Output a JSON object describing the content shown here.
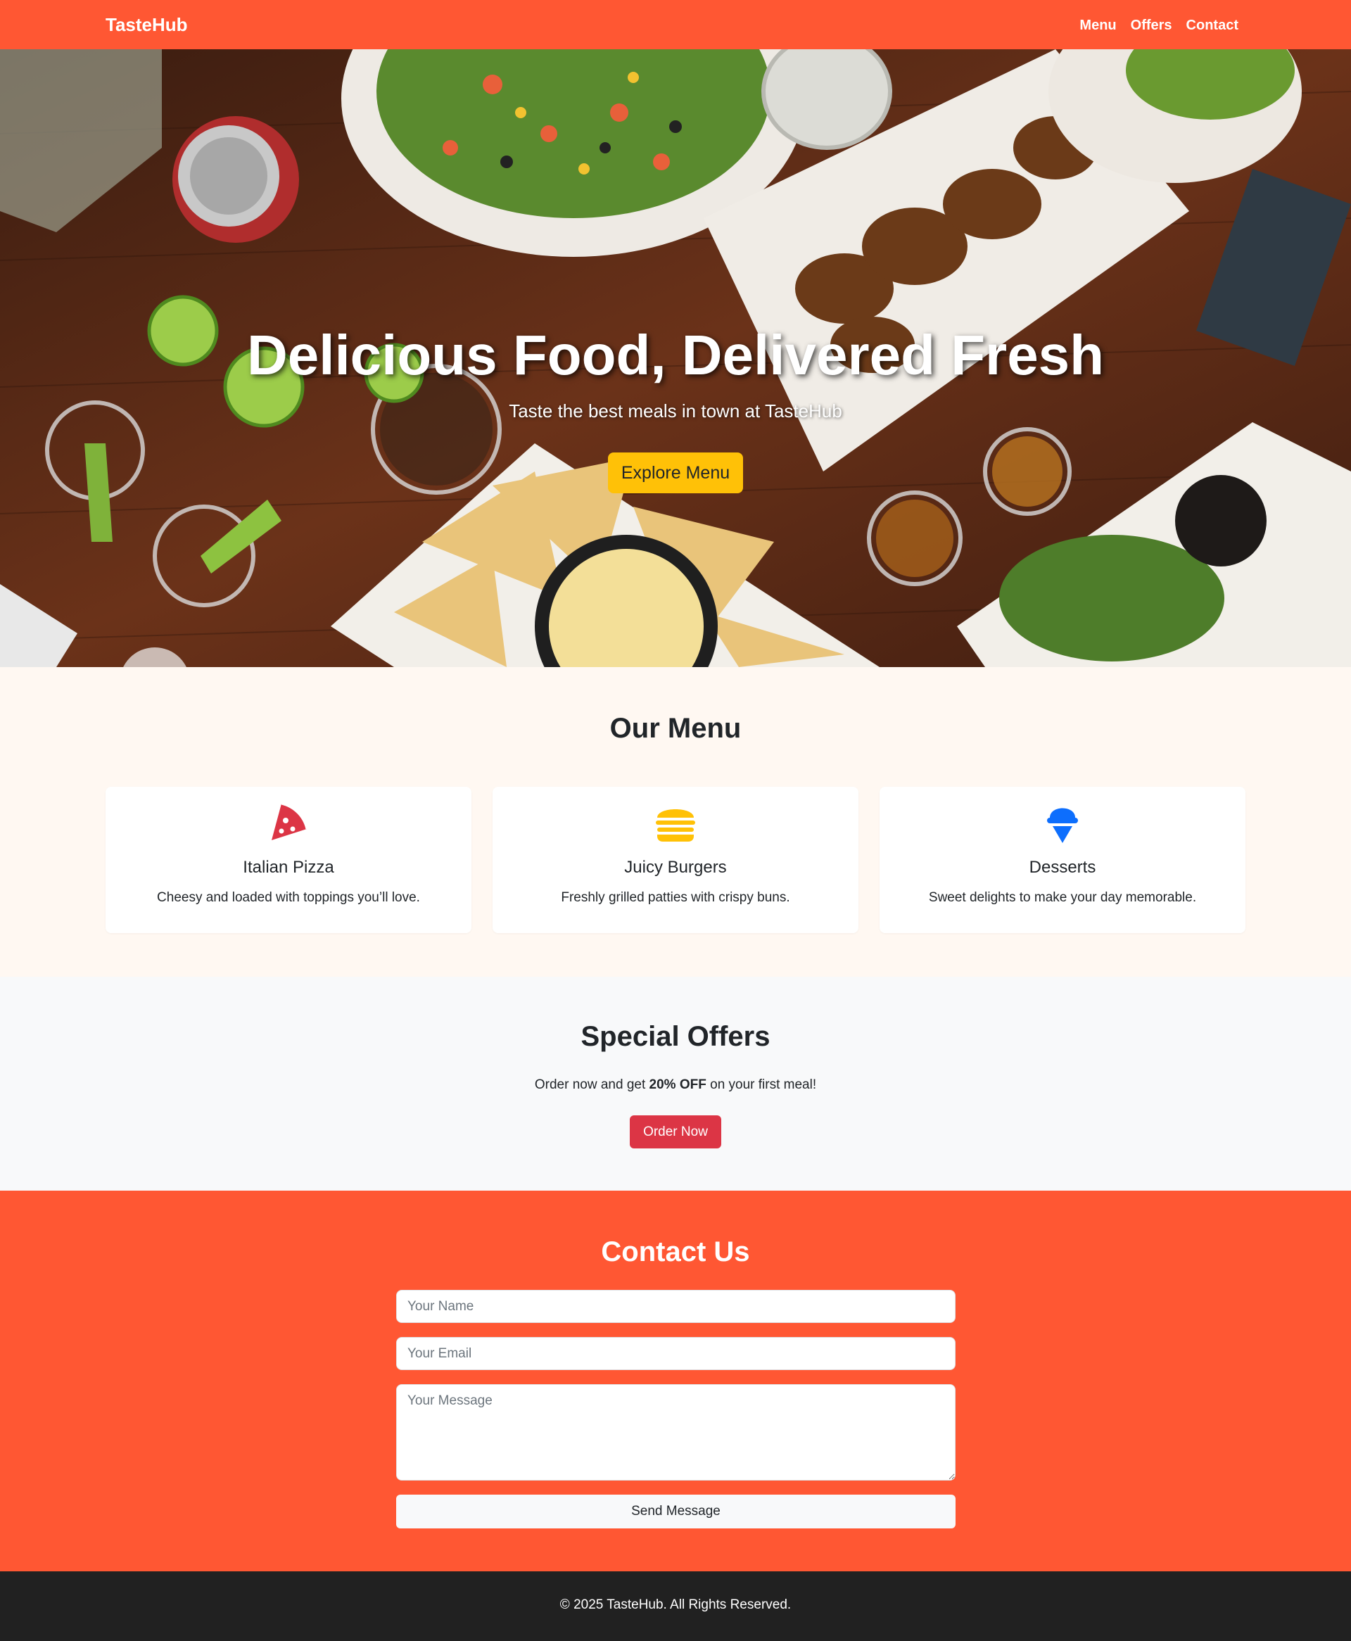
{
  "navbar": {
    "brand": "TasteHub",
    "links": [
      "Menu",
      "Offers",
      "Contact"
    ],
    "color": "#ff5733"
  },
  "hero": {
    "title": "Delicious Food, Delivered Fresh",
    "subtitle": "Taste the best meals in town at TasteHub",
    "button": "Explore Menu",
    "button_color": "#ffc107"
  },
  "menu": {
    "title": "Our Menu",
    "items": [
      {
        "icon": "pizza-icon",
        "icon_color": "#dc3545",
        "title": "Italian Pizza",
        "description": "Cheesy and loaded with toppings you’ll love."
      },
      {
        "icon": "burger-icon",
        "icon_color": "#ffc107",
        "title": "Juicy Burgers",
        "description": "Freshly grilled patties with crispy buns."
      },
      {
        "icon": "ice-cream-icon",
        "icon_color": "#0d6efd",
        "title": "Desserts",
        "description": "Sweet delights to make your day memorable."
      }
    ]
  },
  "offers": {
    "title": "Special Offers",
    "text_before": "Order now and get ",
    "text_bold": "20% OFF",
    "text_after": " on your first meal!",
    "button": "Order Now",
    "button_color": "#dc3545"
  },
  "contact": {
    "title": "Contact Us",
    "name_placeholder": "Your Name",
    "email_placeholder": "Your Email",
    "message_placeholder": "Your Message",
    "button": "Send Message"
  },
  "footer": {
    "text": "© 2025 TasteHub. All Rights Reserved."
  }
}
